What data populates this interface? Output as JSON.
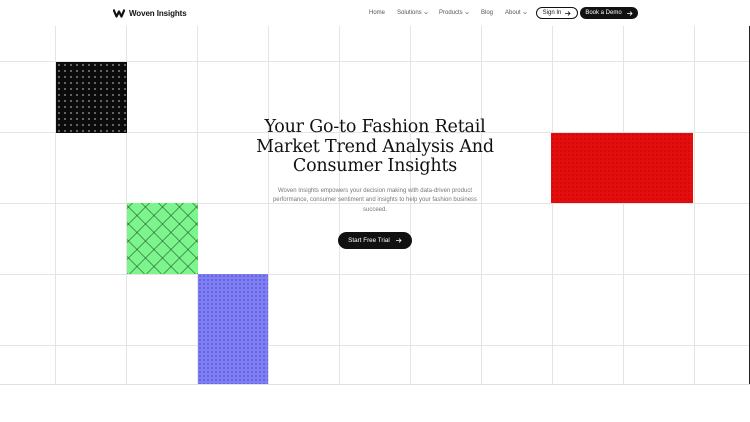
{
  "header": {
    "brand": "Woven Insights",
    "nav": [
      {
        "label": "Home",
        "dropdown": false
      },
      {
        "label": "Solutions",
        "dropdown": true
      },
      {
        "label": "Products",
        "dropdown": true
      },
      {
        "label": "Blog",
        "dropdown": false
      },
      {
        "label": "About",
        "dropdown": true
      }
    ],
    "signin_label": "Sign In",
    "demo_label": "Book a Demo"
  },
  "hero": {
    "title_line1": "Your Go-to Fashion Retail",
    "title_line2": "Market Trend Analysis And",
    "title_line3": "Consumer Insights",
    "description": "Woven Insights empowers your decision making with data-driven product performance, consumer sentiment and insights to help your fashion business succeed.",
    "cta_label": "Start Free Trial"
  },
  "colors": {
    "black_tile": "#0b0b0b",
    "red_tile": "#e30d0d",
    "green_tile": "#7cf58c",
    "purple_tile": "#7f7ef5",
    "text_primary": "#111111",
    "text_muted": "#777777"
  },
  "icons": [
    "woven-logo-icon",
    "chevron-down-icon",
    "arrow-right-icon"
  ]
}
